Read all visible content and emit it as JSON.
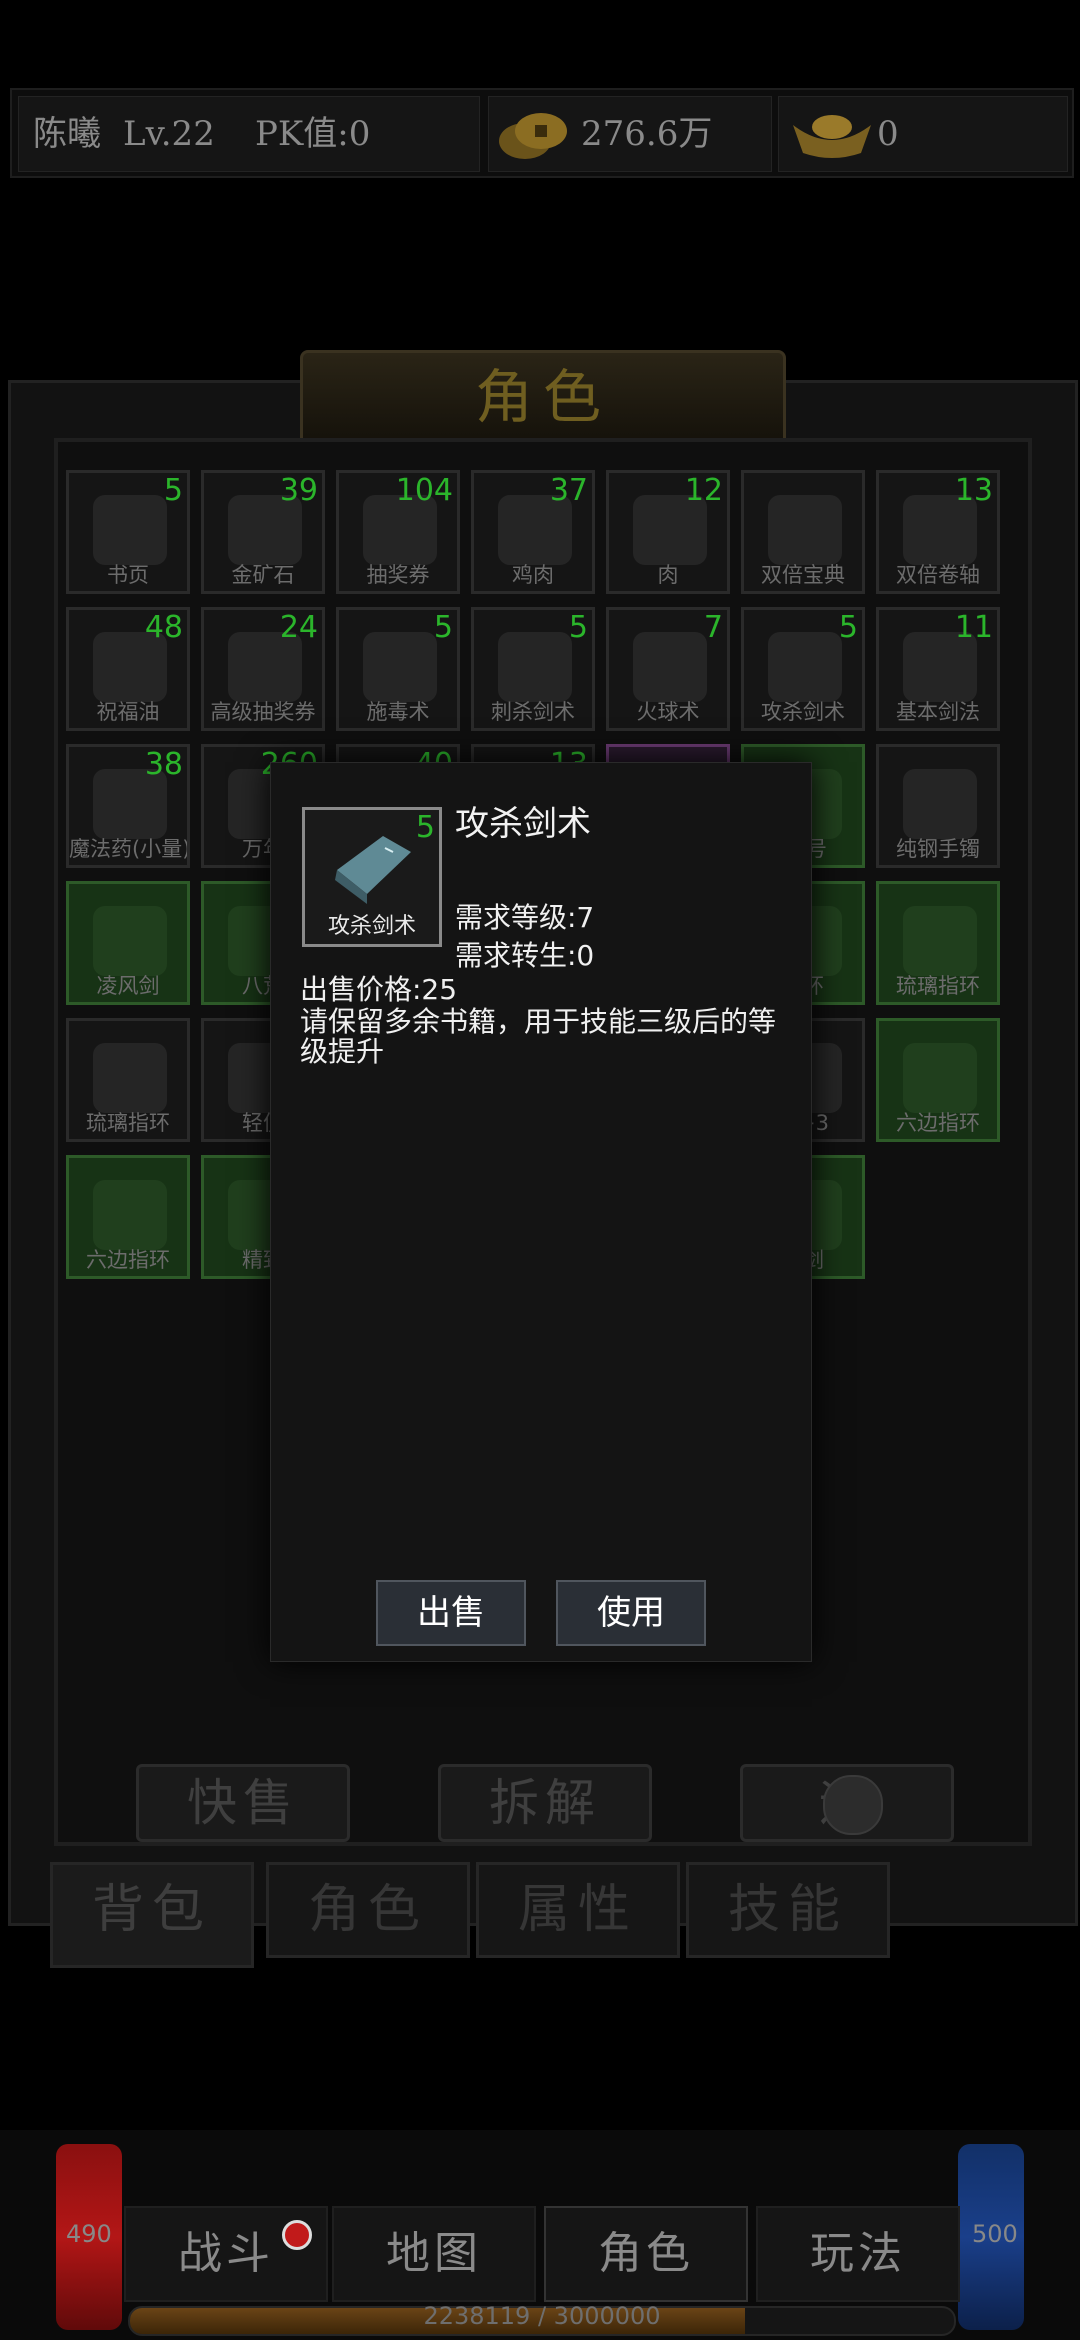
{
  "header": {
    "player_name": "陈曦",
    "level_text": "Lv.22",
    "pk_text": "PK值:0",
    "gold": "276.6万",
    "ingot": "0"
  },
  "panel": {
    "title": "角色"
  },
  "inventory": [
    {
      "name": "书页",
      "count": "5"
    },
    {
      "name": "金矿石",
      "count": "39"
    },
    {
      "name": "抽奖券",
      "count": "104"
    },
    {
      "name": "鸡肉",
      "count": "37"
    },
    {
      "name": "肉",
      "count": "12"
    },
    {
      "name": "双倍宝典",
      "count": ""
    },
    {
      "name": "双倍卷轴",
      "count": "13"
    },
    {
      "name": "祝福油",
      "count": "48"
    },
    {
      "name": "高级抽奖券",
      "count": "24"
    },
    {
      "name": "施毒术",
      "count": "5"
    },
    {
      "name": "刺杀剑术",
      "count": "5"
    },
    {
      "name": "火球术",
      "count": "7"
    },
    {
      "name": "攻杀剑术",
      "count": "5"
    },
    {
      "name": "基本剑法",
      "count": "11"
    },
    {
      "name": "魔法药(小量)",
      "count": "38"
    },
    {
      "name": "万年",
      "count": "260"
    },
    {
      "name": "",
      "count": "40"
    },
    {
      "name": "",
      "count": "13"
    },
    {
      "name": "",
      "count": ""
    },
    {
      "name": "25号",
      "count": ""
    },
    {
      "name": "纯钢手镯",
      "count": ""
    },
    {
      "name": "凌风剑",
      "count": ""
    },
    {
      "name": "八荒",
      "count": ""
    },
    {
      "name": "",
      "count": ""
    },
    {
      "name": "",
      "count": ""
    },
    {
      "name": "",
      "count": ""
    },
    {
      "name": "指环",
      "count": ""
    },
    {
      "name": "琉璃指环",
      "count": ""
    },
    {
      "name": "琉璃指环",
      "count": ""
    },
    {
      "name": "轻便",
      "count": ""
    },
    {
      "name": "",
      "count": ""
    },
    {
      "name": "",
      "count": ""
    },
    {
      "name": "",
      "count": ""
    },
    {
      "name": "石+3",
      "count": ""
    },
    {
      "name": "六边指环",
      "count": ""
    },
    {
      "name": "六边指环",
      "count": ""
    },
    {
      "name": "精致",
      "count": ""
    },
    {
      "name": "",
      "count": ""
    },
    {
      "name": "",
      "count": ""
    },
    {
      "name": "",
      "count": ""
    },
    {
      "name": "长剑",
      "count": ""
    }
  ],
  "actions": {
    "quick_sell": "快售",
    "dismantle": "拆解",
    "third": "运"
  },
  "tabs": [
    "背包",
    "角色",
    "属性",
    "技能"
  ],
  "popup": {
    "item_name": "攻杀剑术",
    "icon_label": "攻杀剑术",
    "icon_count": "5",
    "req_level": "需求等级:7",
    "req_rebirth": "需求转生:0",
    "price": "出售价格:25",
    "desc_line1": "请保留多余书籍，用于技能三级后的等",
    "desc_line2": "级提升",
    "sell_btn": "出售",
    "use_btn": "使用"
  },
  "bottom": {
    "hp": "490",
    "mp": "500",
    "nav": [
      "战斗",
      "地图",
      "角色",
      "玩法"
    ],
    "exp_text": "2238119 / 3000000",
    "exp_fraction": 0.746
  },
  "colors": {
    "count_green": "#2bb52b",
    "slot_green": "#173315",
    "hp_red": "#b31616",
    "mp_blue": "#1a3f8a"
  }
}
